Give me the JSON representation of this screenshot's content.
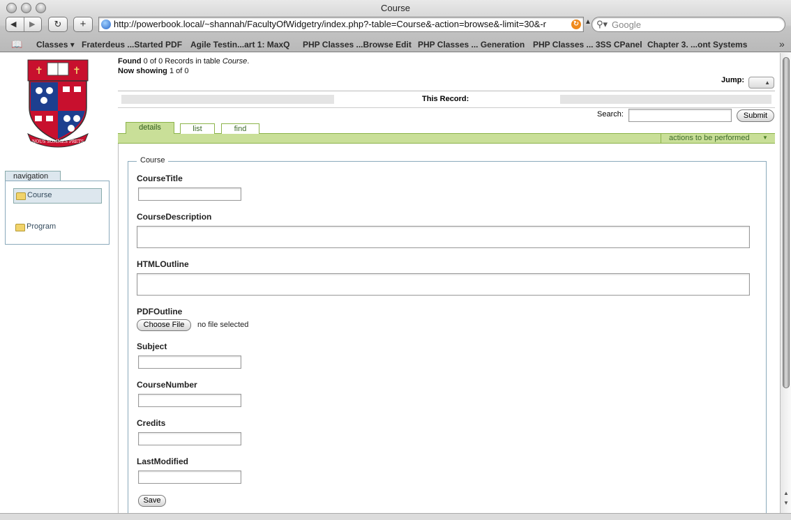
{
  "window": {
    "title": "Course"
  },
  "toolbar": {
    "url": "http://powerbook.local/~shannah/FacultyOfWidgetry/index.php?-table=Course&-action=browse&-limit=30&-r",
    "search_placeholder": "Google",
    "add_label": "+",
    "reload_label": "↻"
  },
  "bookmarks": [
    "Classes ▾",
    "Fraterdeus ...Started PDF",
    "Agile Testin...art 1: MaxQ",
    "PHP Classes ...Browse Edit",
    "PHP Classes ... Generation",
    "PHP Classes ... 3SS CPanel",
    "Chapter 3. ...ont Systems"
  ],
  "crest": {
    "motto": "NOUS SOMMES PRETS"
  },
  "navigation": {
    "title": "navigation",
    "items": [
      {
        "label": "Course",
        "selected": true
      },
      {
        "label": "Program",
        "selected": false
      }
    ]
  },
  "records": {
    "found_word": "Found",
    "found_text": "0 of 0 Records in table",
    "table_name": "Course",
    "showing_word": "Now showing",
    "showing_text": "1 of 0",
    "jump_label": "Jump:",
    "this_record": "This Record:",
    "search_label": "Search:",
    "submit": "Submit"
  },
  "tabs": [
    {
      "label": "details",
      "active": true
    },
    {
      "label": "list",
      "active": false
    },
    {
      "label": "find",
      "active": false
    }
  ],
  "actions_label": "actions to be performed",
  "form": {
    "legend": "Course",
    "fields": {
      "course_title": "CourseTitle",
      "course_description": "CourseDescription",
      "html_outline": "HTMLOutline",
      "pdf_outline": "PDFOutline",
      "subject": "Subject",
      "course_number": "CourseNumber",
      "credits": "Credits",
      "last_modified": "LastModified"
    },
    "choose_file": "Choose File",
    "no_file": "no file selected",
    "save": "Save"
  }
}
